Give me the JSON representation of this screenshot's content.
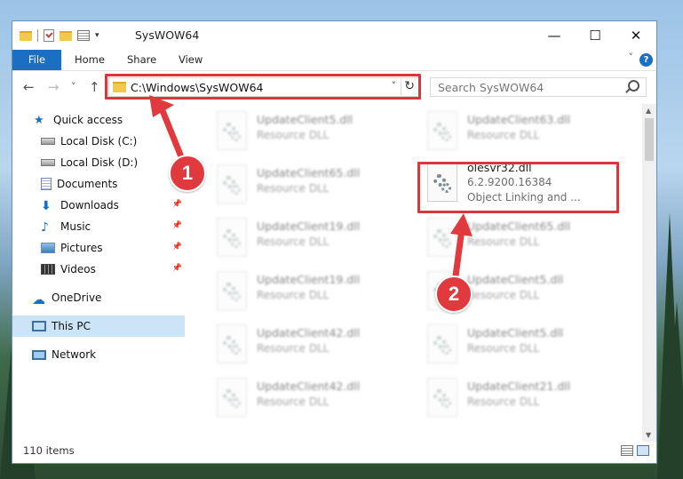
{
  "window": {
    "title": "SysWOW64",
    "min_glyph": "—",
    "max_glyph": "☐",
    "close_glyph": "✕"
  },
  "ribbon": {
    "tabs": [
      "File",
      "Home",
      "Share",
      "View"
    ],
    "help": "?"
  },
  "navigation": {
    "back": "←",
    "forward": "→",
    "recent": "˅",
    "up": "↑",
    "address": "C:\\Windows\\SysWOW64",
    "dropdown": "˅",
    "refresh": "↻",
    "search_placeholder": "Search SysWOW64"
  },
  "sidebar": {
    "items": [
      {
        "label": "Quick access",
        "icon": "star-icon"
      },
      {
        "label": "Local Disk (C:)",
        "icon": "drive-icon"
      },
      {
        "label": "Local Disk (D:)",
        "icon": "drive-icon"
      },
      {
        "label": "Documents",
        "icon": "documents-icon"
      },
      {
        "label": "Downloads",
        "icon": "downloads-icon"
      },
      {
        "label": "Music",
        "icon": "music-icon"
      },
      {
        "label": "Pictures",
        "icon": "pictures-icon"
      },
      {
        "label": "Videos",
        "icon": "videos-icon"
      },
      {
        "label": "OneDrive",
        "icon": "cloud-icon"
      },
      {
        "label": "This PC",
        "icon": "computer-icon"
      },
      {
        "label": "Network",
        "icon": "network-icon"
      }
    ],
    "pin": "📌"
  },
  "files": {
    "left": [
      {
        "name": "UpdateClient5.dll",
        "type": "Resource DLL"
      },
      {
        "name": "UpdateClient65.dll",
        "type": "Resource DLL"
      },
      {
        "name": "UpdateClient19.dll",
        "type": "Resource DLL"
      },
      {
        "name": "UpdateClient19.dll",
        "type": "Resource DLL"
      },
      {
        "name": "UpdateClient42.dll",
        "type": "Resource DLL"
      },
      {
        "name": "UpdateClient42.dll",
        "type": "Resource DLL"
      }
    ],
    "right": [
      {
        "name": "UpdateClient63.dll",
        "type": "Resource DLL"
      },
      {
        "name": "olesvr32.dll",
        "version": "6.2.9200.16384",
        "type": "Object Linking and ..."
      },
      {
        "name": "UpdateClient65.dll",
        "type": "Resource DLL"
      },
      {
        "name": "UpdateClient5.dll",
        "type": "Resource DLL"
      },
      {
        "name": "UpdateClient5.dll",
        "type": "Resource DLL"
      },
      {
        "name": "UpdateClient21.dll",
        "type": "Resource DLL"
      }
    ]
  },
  "status": {
    "item_count": "110 items"
  },
  "callouts": {
    "one": "1",
    "two": "2"
  },
  "colors": {
    "accent": "#1a6fc2",
    "highlight": "#d9363e",
    "selection": "#cce4f7"
  }
}
